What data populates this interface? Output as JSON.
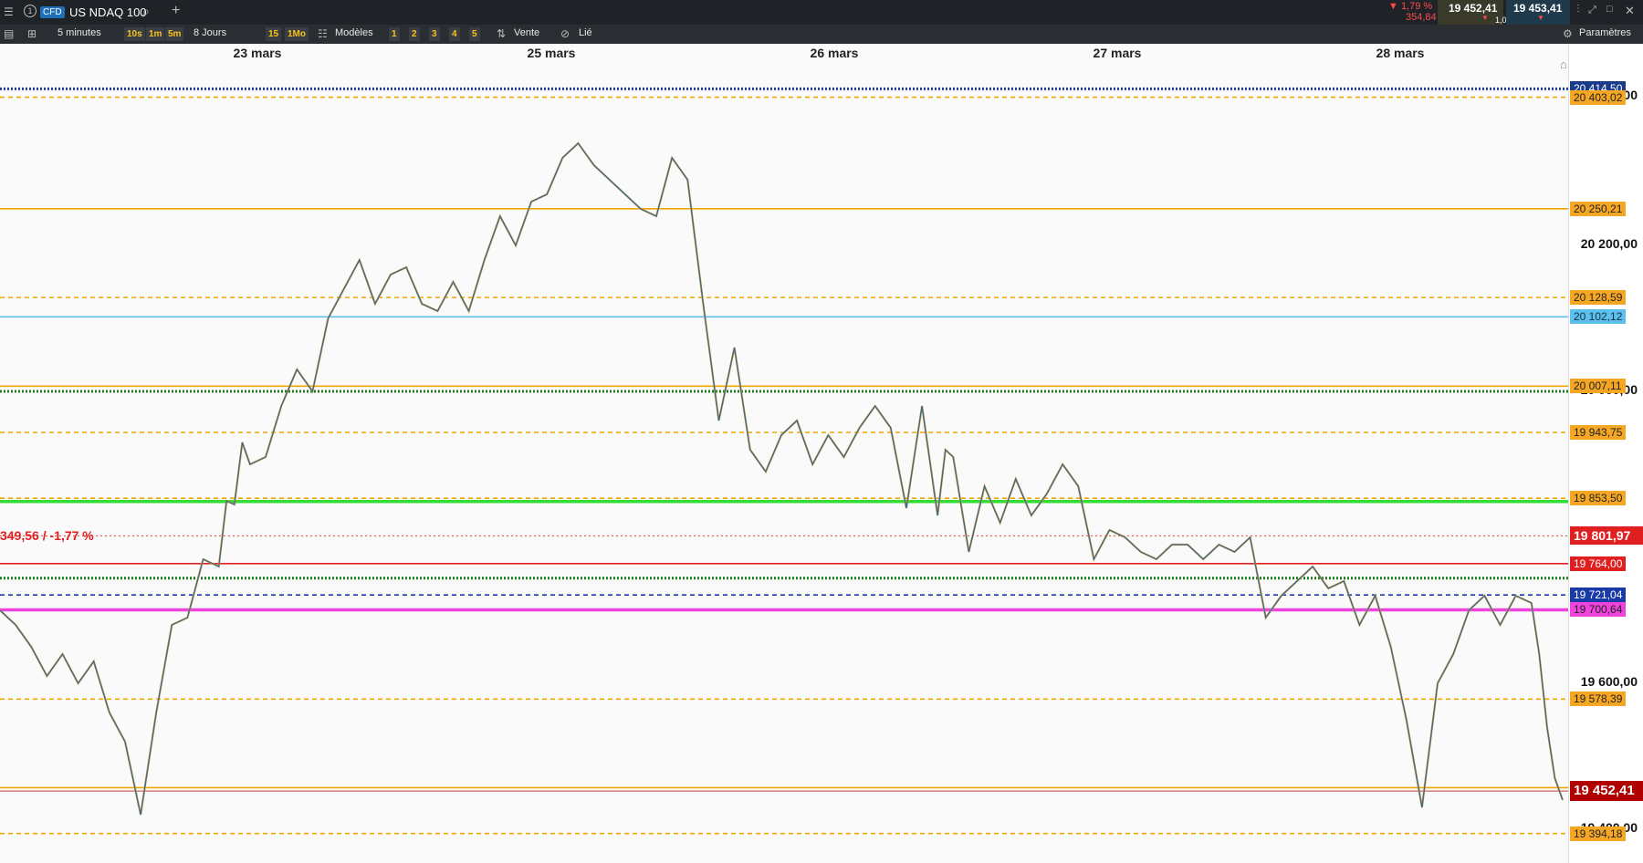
{
  "header": {
    "instrument_type": "CFD",
    "instrument_name": "US NDAQ 100",
    "change_pct": "▼ 1,79 %",
    "change_abs": "354,84",
    "bid": "19 452,41",
    "ask": "19 453,41",
    "spread": "1,00",
    "info_number": "1"
  },
  "toolbar": {
    "interval": "5 minutes",
    "quick_intervals": [
      "10s",
      "1m",
      "5m"
    ],
    "range": "8 Jours",
    "quick_ranges": [
      "15",
      "1Mo"
    ],
    "templates_label": "Modèles",
    "slots": [
      "1",
      "2",
      "3",
      "4",
      "5"
    ],
    "order_label": "Vente",
    "link_label": "Lié",
    "settings_label": "Paramètres"
  },
  "chart_data": {
    "type": "line",
    "instrument": "US NDAQ 100",
    "x_dates": [
      "23 mars",
      "25 mars",
      "26 mars",
      "27 mars",
      "28 mars"
    ],
    "ylim": [
      19370,
      20430
    ],
    "y_ticks": [
      "20 200,00",
      "19 600,00"
    ],
    "y_ticks_partial": [
      "20 400,00",
      "20 000,00",
      "19 400,00"
    ],
    "last_price": 19452.41,
    "last_price_label": "19 452,41",
    "reference_price": 19801.97,
    "reference_price_label": "19 801,97",
    "change_annotation": "349,56 / -1,77 %",
    "levels": [
      {
        "value": 20414.5,
        "label": "20 414,50",
        "style": "dotted",
        "color": "#1a3a8a",
        "bg": "#1a3a8a",
        "fg": "#ffffff"
      },
      {
        "value": 20403.02,
        "label": "20 403,02",
        "style": "dashed",
        "color": "#f0a500",
        "bg": "#f5a623",
        "fg": "#222222"
      },
      {
        "value": 20250.21,
        "label": "20 250,21",
        "style": "solid",
        "color": "#f0a500",
        "bg": "#f5a623",
        "fg": "#222222"
      },
      {
        "value": 20128.59,
        "label": "20 128,59",
        "style": "dashed",
        "color": "#f0a500",
        "bg": "#f5a623",
        "fg": "#222222"
      },
      {
        "value": 20102.12,
        "label": "20 102,12",
        "style": "solid",
        "color": "#5bc0eb",
        "bg": "#5bc0eb",
        "fg": "#123044"
      },
      {
        "value": 20007.11,
        "label": "20 007,11",
        "style": "solid",
        "color": "#f0a500",
        "bg": "#f5a623",
        "fg": "#222222"
      },
      {
        "value": 20000.0,
        "label": "",
        "style": "dotted",
        "color": "#1a7a1a",
        "bg": "",
        "fg": ""
      },
      {
        "value": 19943.75,
        "label": "19 943,75",
        "style": "dashed",
        "color": "#f0a500",
        "bg": "#f5a623",
        "fg": "#222222"
      },
      {
        "value": 19853.5,
        "label": "19 853,50",
        "style": "dashed",
        "color": "#f0a500",
        "bg": "#f5a623",
        "fg": "#222222"
      },
      {
        "value": 19849.0,
        "label": "",
        "style": "solid-thick",
        "color": "#33dd33",
        "bg": "",
        "fg": ""
      },
      {
        "value": 19764.0,
        "label": "19 764,00",
        "style": "solid",
        "color": "#e02020",
        "bg": "#e02020",
        "fg": "#ffffff"
      },
      {
        "value": 19744.0,
        "label": "",
        "style": "dotted",
        "color": "#1a7a1a",
        "bg": "",
        "fg": ""
      },
      {
        "value": 19721.04,
        "label": "19 721,04",
        "style": "dashed",
        "color": "#1a3aa8",
        "bg": "#1a3aa8",
        "fg": "#ffffff"
      },
      {
        "value": 19700.64,
        "label": "19 700,64",
        "style": "solid-thick",
        "color": "#ee44dd",
        "bg": "#ee44dd",
        "fg": "#222222"
      },
      {
        "value": 19578.39,
        "label": "19 578,39",
        "style": "dashed",
        "color": "#f0a500",
        "bg": "#f5a623",
        "fg": "#222222"
      },
      {
        "value": 19457.0,
        "label": "",
        "style": "solid",
        "color": "#f0a500",
        "bg": "",
        "fg": ""
      },
      {
        "value": 19394.18,
        "label": "19 394,18",
        "style": "dashed",
        "color": "#f0a500",
        "bg": "#f5a623",
        "fg": "#222222"
      }
    ],
    "series": [
      {
        "x": [
          0,
          0.01,
          0.02,
          0.03,
          0.04,
          0.05,
          0.06,
          0.07,
          0.08,
          0.09,
          0.1,
          0.11,
          0.12,
          0.13,
          0.14,
          0.145,
          0.15,
          0.155,
          0.16,
          0.17,
          0.18,
          0.19,
          0.2,
          0.21,
          0.22,
          0.23,
          0.24,
          0.25,
          0.26,
          0.27,
          0.28,
          0.29,
          0.3,
          0.31,
          0.32,
          0.33,
          0.34,
          0.35,
          0.36,
          0.37,
          0.38,
          0.39,
          0.4,
          0.41,
          0.42,
          0.43,
          0.44,
          0.45,
          0.46,
          0.47,
          0.48,
          0.49,
          0.5,
          0.51,
          0.52,
          0.53,
          0.54,
          0.55,
          0.56,
          0.57,
          0.58,
          0.59,
          0.6,
          0.605,
          0.61,
          0.62,
          0.63,
          0.64,
          0.65,
          0.66,
          0.67,
          0.68,
          0.69,
          0.7,
          0.71,
          0.72,
          0.73,
          0.74,
          0.75,
          0.76,
          0.77,
          0.78,
          0.79,
          0.8,
          0.81,
          0.82,
          0.83,
          0.84,
          0.85,
          0.86,
          0.87,
          0.88,
          0.89,
          0.9,
          0.91,
          0.92,
          0.93,
          0.94,
          0.95,
          0.96,
          0.97,
          0.98,
          0.985,
          0.99,
          0.995,
          1.0
        ],
        "y": [
          19700,
          19680,
          19650,
          19610,
          19640,
          19600,
          19630,
          19560,
          19520,
          19420,
          19560,
          19680,
          19690,
          19770,
          19760,
          19850,
          19845,
          19930,
          19900,
          19910,
          19980,
          20030,
          20000,
          20100,
          20140,
          20180,
          20120,
          20160,
          20170,
          20120,
          20110,
          20150,
          20110,
          20180,
          20240,
          20200,
          20260,
          20270,
          20320,
          20340,
          20310,
          20290,
          20270,
          20250,
          20240,
          20320,
          20290,
          20120,
          19960,
          20060,
          19920,
          19890,
          19940,
          19960,
          19900,
          19940,
          19910,
          19950,
          19980,
          19950,
          19840,
          19980,
          19830,
          19920,
          19910,
          19780,
          19870,
          19820,
          19880,
          19830,
          19860,
          19900,
          19870,
          19770,
          19810,
          19800,
          19780,
          19770,
          19790,
          19790,
          19770,
          19790,
          19780,
          19800,
          19690,
          19720,
          19740,
          19760,
          19730,
          19740,
          19680,
          19720,
          19650,
          19550,
          19430,
          19600,
          19640,
          19700,
          19720,
          19680,
          19720,
          19710,
          19640,
          19540,
          19470,
          19440
        ],
        "color": "#2a6a9e"
      }
    ]
  }
}
